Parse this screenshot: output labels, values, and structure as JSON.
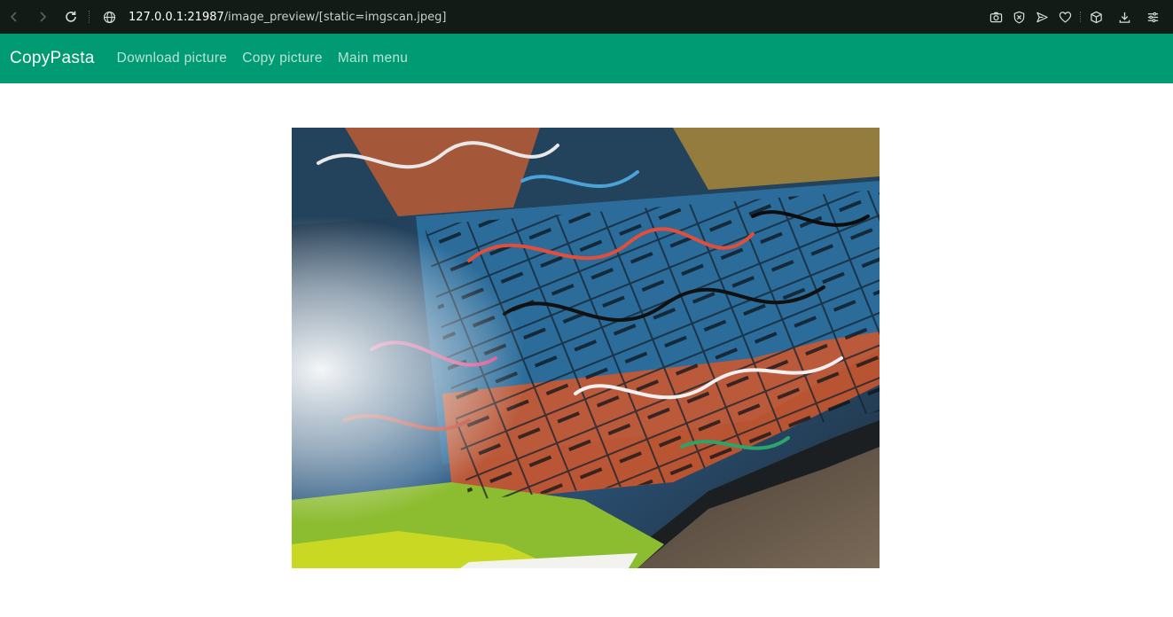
{
  "browser": {
    "url_host": "127.0.0.1:21987",
    "url_path": "/image_preview/[static=imgscan.jpeg]",
    "icons": [
      "back-icon",
      "forward-icon",
      "reload-icon",
      "globe-icon",
      "camera-icon",
      "shield-icon",
      "send-icon",
      "heart-icon",
      "cube-icon",
      "download-icon",
      "menu-icon"
    ]
  },
  "navbar": {
    "brand": "CopyPasta",
    "links": [
      "Download picture",
      "Copy picture",
      "Main menu"
    ],
    "background": "#009b72"
  },
  "preview": {
    "description_colors": [
      "#1f5a86",
      "#d9532a",
      "#8ab92e",
      "#1a1a1a",
      "#6b5a48"
    ]
  }
}
